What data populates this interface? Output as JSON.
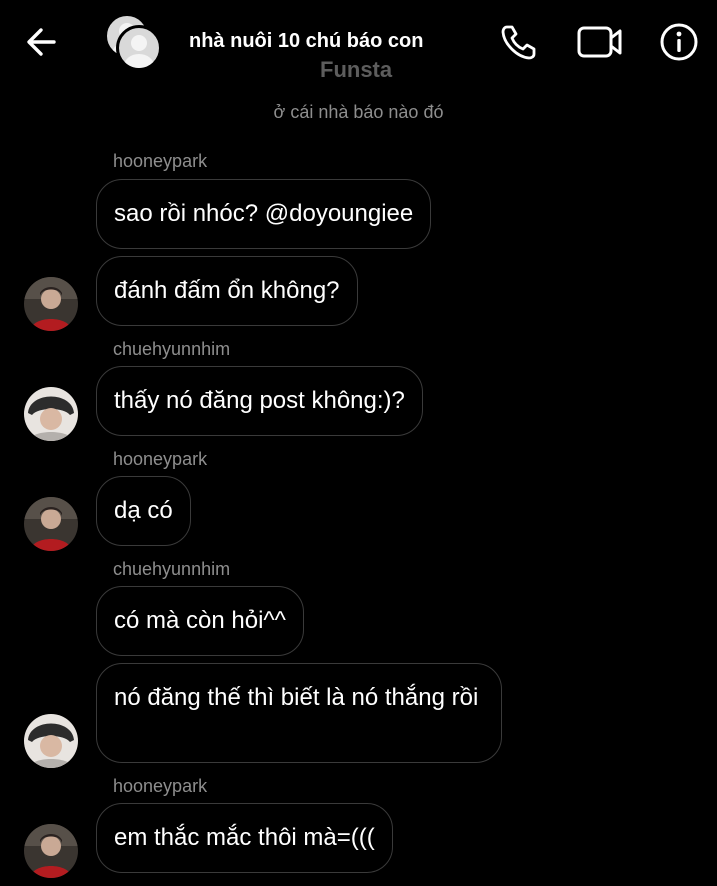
{
  "header": {
    "title": "nhà nuôi 10 chú báo con",
    "subtitle": "Funsta",
    "icons": [
      "back-arrow-icon",
      "phone-icon",
      "video-camera-icon",
      "info-icon"
    ]
  },
  "nickname_notice": "ở cái nhà báo nào đó",
  "messages": [
    {
      "sender": "hooneypark",
      "text": "sao rồi nhóc? @doyoungiee"
    },
    {
      "text": "đánh đấm ổn không?"
    },
    {
      "sender": "chuehyunnhim",
      "text": "thấy nó đăng post không:)?"
    },
    {
      "sender": "hooneypark",
      "text": "dạ có"
    },
    {
      "sender": "chuehyunnhim",
      "text": "có mà còn hỏi^^"
    },
    {
      "text": "nó đăng thế thì biết là nó thắng rồi"
    },
    {
      "sender": "hooneypark",
      "text": "em thắc mắc thôi mà=((("
    }
  ],
  "colors": {
    "background": "#000000",
    "bubble_border": "#3a3a3a",
    "muted_text": "#8e8e8e"
  }
}
